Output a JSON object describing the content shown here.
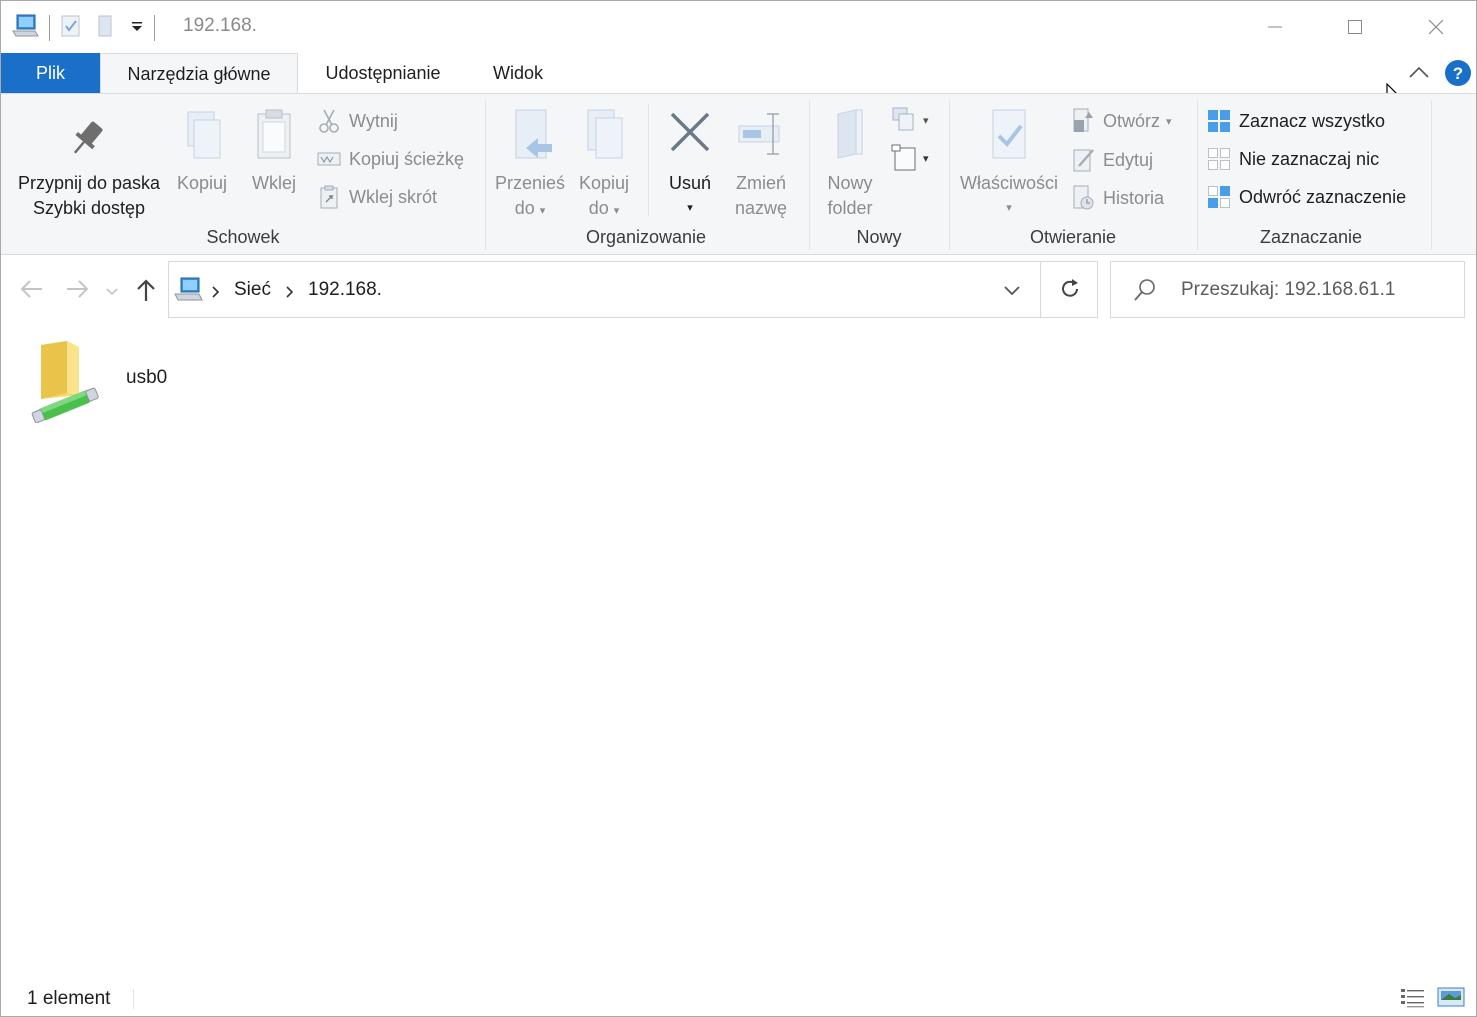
{
  "window": {
    "title": "192.168."
  },
  "tabs": {
    "file": "Plik",
    "home": "Narzędzia główne",
    "share": "Udostępnianie",
    "view": "Widok"
  },
  "ribbon": {
    "clipboard": {
      "group_label": "Schowek",
      "pin_line1": "Przypnij do paska",
      "pin_line2": "Szybki dostęp",
      "copy": "Kopiuj",
      "paste": "Wklej",
      "cut": "Wytnij",
      "copy_path": "Kopiuj ścieżkę",
      "paste_shortcut": "Wklej skrót"
    },
    "organize": {
      "group_label": "Organizowanie",
      "move_line1": "Przenieś",
      "move_line2": "do",
      "copy_line1": "Kopiuj",
      "copy_line2": "do",
      "delete": "Usuń",
      "rename_line1": "Zmień",
      "rename_line2": "nazwę"
    },
    "new": {
      "group_label": "Nowy",
      "folder_line1": "Nowy",
      "folder_line2": "folder"
    },
    "open": {
      "group_label": "Otwieranie",
      "properties": "Właściwości",
      "open": "Otwórz",
      "edit": "Edytuj",
      "history": "Historia"
    },
    "select": {
      "group_label": "Zaznaczanie",
      "select_all": "Zaznacz wszystko",
      "select_none": "Nie zaznaczaj nic",
      "invert": "Odwróć zaznaczenie"
    }
  },
  "address": {
    "crumbs": [
      "Sieć",
      "192.168."
    ]
  },
  "search": {
    "placeholder": "Przeszukaj: 192.168.61.1"
  },
  "items": [
    {
      "name": "usb0",
      "icon": "shared-folder-icon"
    }
  ],
  "status": {
    "count": "1 element"
  },
  "colors": {
    "accent": "#1a6fc8",
    "ribbon_bg": "#f5f6f7"
  }
}
